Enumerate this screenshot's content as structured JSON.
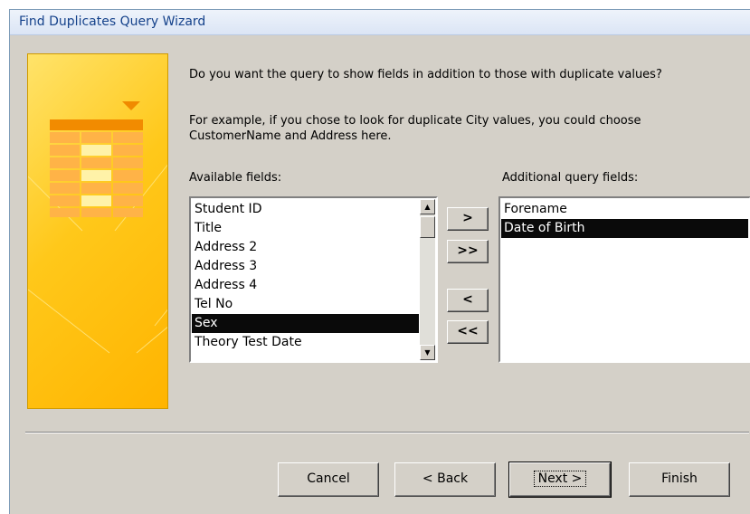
{
  "window": {
    "title": "Find Duplicates Query Wizard"
  },
  "prompt": {
    "question": "Do you want the query to show fields in addition to those with duplicate values?",
    "example": "For example, if you chose to look for duplicate City values, you could choose CustomerName and Address here."
  },
  "available": {
    "label": "Available fields:",
    "items": [
      {
        "label": "Student ID",
        "selected": false
      },
      {
        "label": "Title",
        "selected": false
      },
      {
        "label": "Address 2",
        "selected": false
      },
      {
        "label": "Address 3",
        "selected": false
      },
      {
        "label": "Address 4",
        "selected": false
      },
      {
        "label": "Tel No",
        "selected": false
      },
      {
        "label": "Sex",
        "selected": true
      },
      {
        "label": "Theory Test Date",
        "selected": false
      }
    ]
  },
  "additional": {
    "label": "Additional query fields:",
    "items": [
      {
        "label": "Forename",
        "selected": false
      },
      {
        "label": "Date of Birth",
        "selected": true
      }
    ]
  },
  "move_buttons": {
    "add_one": ">",
    "add_all": ">>",
    "remove_one": "<",
    "remove_all": "<<"
  },
  "buttons": {
    "cancel": "Cancel",
    "back": "< Back",
    "next": "Next >",
    "finish": "Finish"
  },
  "colors": {
    "selection": "#0a0a0a",
    "title_text": "#15428b",
    "banner": "#ffc81a",
    "dialog_bg": "#d4d0c8"
  },
  "icons": [
    "table-illustration-icon",
    "scroll-up-arrow-icon",
    "scroll-down-arrow-icon"
  ]
}
